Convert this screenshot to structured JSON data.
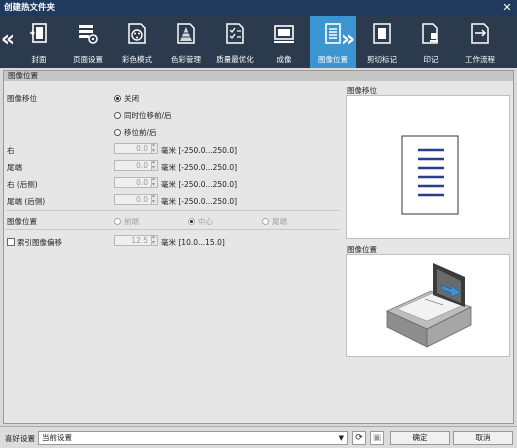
{
  "window": {
    "title": "创建热文件夹",
    "close_label": "✕"
  },
  "toolbar": {
    "prev_label": "«",
    "next_label": "»",
    "items": [
      {
        "label": "封面",
        "icon": "cover-icon"
      },
      {
        "label": "页面设置",
        "icon": "page-setup-icon"
      },
      {
        "label": "彩色模式",
        "icon": "color-mode-icon"
      },
      {
        "label": "色彩管理",
        "icon": "color-management-icon"
      },
      {
        "label": "质量最优化",
        "icon": "quality-optimize-icon"
      },
      {
        "label": "成像",
        "icon": "imaging-icon"
      },
      {
        "label": "图像位置",
        "icon": "image-position-icon",
        "active": true
      },
      {
        "label": "剪切标记",
        "icon": "crop-marks-icon"
      },
      {
        "label": "印记",
        "icon": "stamp-icon"
      },
      {
        "label": "工作流程",
        "icon": "workflow-icon"
      }
    ]
  },
  "panel": {
    "header": "图像位置",
    "image_shift": {
      "label": "图像移位",
      "options": [
        "关闭",
        "同时位移前/后",
        "移位前/后"
      ],
      "selected": "关闭"
    },
    "fields": [
      {
        "label": "右",
        "value": "0.0",
        "unit": "毫米 [-250.0...250.0]"
      },
      {
        "label": "尾端",
        "value": "0.0",
        "unit": "毫米 [-250.0...250.0]"
      },
      {
        "label": "右 (后侧)",
        "value": "0.0",
        "unit": "毫米 [-250.0...250.0]"
      },
      {
        "label": "尾端 (后侧)",
        "value": "0.0",
        "unit": "毫米 [-250.0...250.0]"
      }
    ],
    "image_position": {
      "label": "图像位置",
      "options": [
        "前端",
        "中心",
        "尾端"
      ],
      "selected": "中心"
    },
    "index_shift": {
      "label": "索引图像偏移",
      "checked": false,
      "value": "12.5",
      "unit": "毫米 [10.0...15.0]"
    },
    "preview_shift_label": "图像移位",
    "preview_position_label": "图像位置"
  },
  "bottom": {
    "favorite_label": "喜好设置",
    "favorite_value": "当前设置",
    "ok_label": "确定",
    "cancel_label": "取消"
  }
}
